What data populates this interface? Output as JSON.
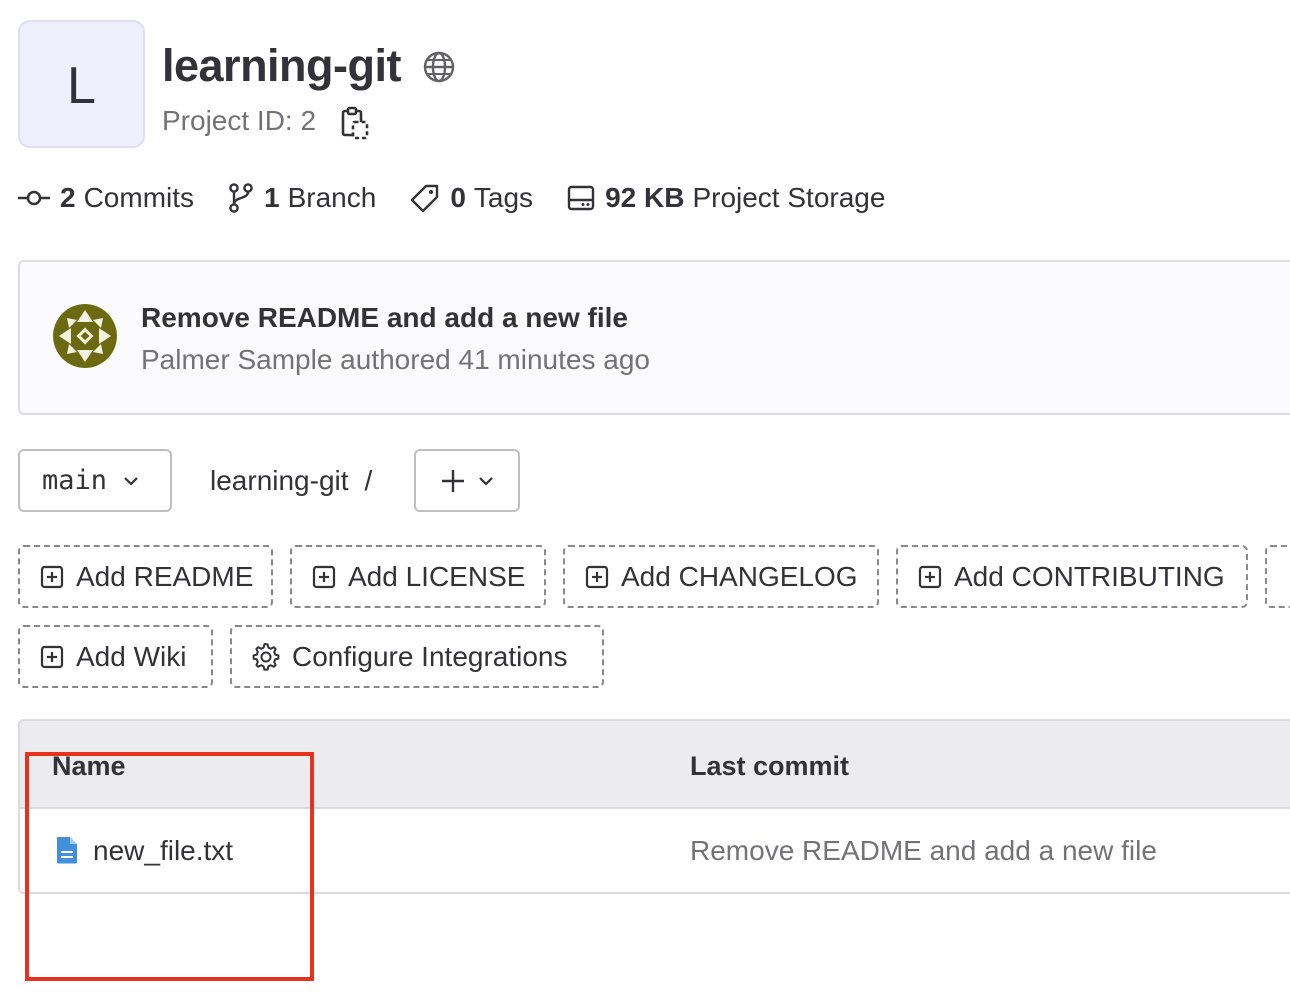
{
  "project": {
    "avatar_letter": "L",
    "name": "learning-git",
    "id_label": "Project ID: 2"
  },
  "stats": [
    {
      "icon": "commit-icon",
      "count": "2",
      "label": "Commits"
    },
    {
      "icon": "branch-icon",
      "count": "1",
      "label": "Branch"
    },
    {
      "icon": "tag-icon",
      "count": "0",
      "label": "Tags"
    },
    {
      "icon": "storage-icon",
      "count": "92 KB",
      "label": "Project Storage"
    }
  ],
  "last_commit": {
    "title": "Remove README and add a new file",
    "meta": "Palmer Sample authored 41 minutes ago"
  },
  "repo_nav": {
    "branch": "main",
    "breadcrumb_root": "learning-git",
    "breadcrumb_sep": "/"
  },
  "quick_actions": [
    {
      "label": "Add README",
      "icon": "plus-square-icon"
    },
    {
      "label": "Add LICENSE",
      "icon": "plus-square-icon"
    },
    {
      "label": "Add CHANGELOG",
      "icon": "plus-square-icon"
    },
    {
      "label": "Add CONTRIBUTING",
      "icon": "plus-square-icon"
    },
    {
      "label": "Add Wiki",
      "icon": "plus-square-icon"
    },
    {
      "label": "Configure Integrations",
      "icon": "gear-icon"
    }
  ],
  "file_table": {
    "headers": {
      "name": "Name",
      "last_commit": "Last commit"
    },
    "rows": [
      {
        "name": "new_file.txt",
        "last_commit": "Remove README and add a new file",
        "icon": "file-icon"
      }
    ]
  },
  "colors": {
    "accent_highlight": "#e8311f",
    "file_icon": "#428fdc",
    "avatar_bg": "#f0effd",
    "muted_text": "#737278"
  }
}
